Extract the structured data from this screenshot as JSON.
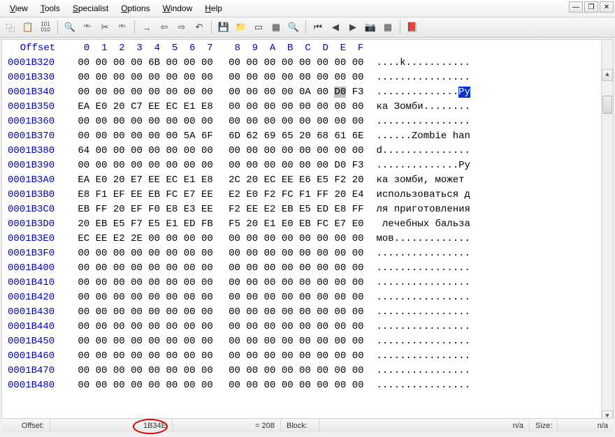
{
  "menu": {
    "view": {
      "u": "V",
      "rest": "iew"
    },
    "tools": {
      "u": "T",
      "rest": "ools"
    },
    "specialist": {
      "u": "S",
      "rest": "pecialist"
    },
    "options": {
      "u": "O",
      "rest": "ptions"
    },
    "window": {
      "u": "W",
      "rest": "indow"
    },
    "help": {
      "u": "H",
      "rest": "elp"
    }
  },
  "toolbar_icons": {
    "copy": "⿻",
    "paste": "📋",
    "binary": "101\n010",
    "find": "🔍",
    "hex1": "ᴴᴱˣ",
    "tool1": "✂",
    "tool2": "ᴴᴱˣ",
    "go": "→",
    "back": "⇦",
    "fwd": "⇨",
    "undo": "↶",
    "disk": "💾",
    "folder": "📁",
    "ram": "▭",
    "calc": "▦",
    "zoom": "🔍",
    "nav1": "⏮",
    "nav2": "◀",
    "nav3": "▶",
    "cam": "📷",
    "grid": "▦",
    "help": "📕"
  },
  "header": {
    "offset_label": "Offset",
    "cols": [
      "0",
      "1",
      "2",
      "3",
      "4",
      "5",
      "6",
      "7",
      "8",
      "9",
      "A",
      "B",
      "C",
      "D",
      "E",
      "F"
    ]
  },
  "rows": [
    {
      "off": "0001B320",
      "h": [
        "00",
        "00",
        "00",
        "00",
        "6B",
        "00",
        "00",
        "00",
        "00",
        "00",
        "00",
        "00",
        "00",
        "00",
        "00",
        "00"
      ],
      "a": "....k..........."
    },
    {
      "off": "0001B330",
      "h": [
        "00",
        "00",
        "00",
        "00",
        "00",
        "00",
        "00",
        "00",
        "00",
        "00",
        "00",
        "00",
        "00",
        "00",
        "00",
        "00"
      ],
      "a": "................"
    },
    {
      "off": "0001B340",
      "h": [
        "00",
        "00",
        "00",
        "00",
        "00",
        "00",
        "00",
        "00",
        "00",
        "00",
        "00",
        "00",
        "0A",
        "00",
        "D0",
        "F3"
      ],
      "a": "..............Ру",
      "sel": 14,
      "hl_start": 14,
      "hl_end": 15
    },
    {
      "off": "0001B350",
      "h": [
        "EA",
        "E0",
        "20",
        "C7",
        "EE",
        "EC",
        "E1",
        "E8",
        "00",
        "00",
        "00",
        "00",
        "00",
        "00",
        "00",
        "00"
      ],
      "a": "ка Зомби........"
    },
    {
      "off": "0001B360",
      "h": [
        "00",
        "00",
        "00",
        "00",
        "00",
        "00",
        "00",
        "00",
        "00",
        "00",
        "00",
        "00",
        "00",
        "00",
        "00",
        "00"
      ],
      "a": "................"
    },
    {
      "off": "0001B370",
      "h": [
        "00",
        "00",
        "00",
        "00",
        "00",
        "00",
        "5A",
        "6F",
        "6D",
        "62",
        "69",
        "65",
        "20",
        "68",
        "61",
        "6E"
      ],
      "a": "......Zombie han"
    },
    {
      "off": "0001B380",
      "h": [
        "64",
        "00",
        "00",
        "00",
        "00",
        "00",
        "00",
        "00",
        "00",
        "00",
        "00",
        "00",
        "00",
        "00",
        "00",
        "00"
      ],
      "a": "d..............."
    },
    {
      "off": "0001B390",
      "h": [
        "00",
        "00",
        "00",
        "00",
        "00",
        "00",
        "00",
        "00",
        "00",
        "00",
        "00",
        "00",
        "00",
        "00",
        "D0",
        "F3"
      ],
      "a": "..............Ру"
    },
    {
      "off": "0001B3A0",
      "h": [
        "EA",
        "E0",
        "20",
        "E7",
        "EE",
        "EC",
        "E1",
        "E8",
        "2C",
        "20",
        "EC",
        "EE",
        "E6",
        "E5",
        "F2",
        "20"
      ],
      "a": "ка зомби, может "
    },
    {
      "off": "0001B3B0",
      "h": [
        "E8",
        "F1",
        "EF",
        "EE",
        "EB",
        "FC",
        "E7",
        "EE",
        "E2",
        "E0",
        "F2",
        "FC",
        "F1",
        "FF",
        "20",
        "E4"
      ],
      "a": "использоваться д"
    },
    {
      "off": "0001B3C0",
      "h": [
        "EB",
        "FF",
        "20",
        "EF",
        "F0",
        "E8",
        "E3",
        "EE",
        "F2",
        "EE",
        "E2",
        "EB",
        "E5",
        "ED",
        "E8",
        "FF"
      ],
      "a": "ля приготовления"
    },
    {
      "off": "0001B3D0",
      "h": [
        "20",
        "EB",
        "E5",
        "F7",
        "E5",
        "E1",
        "ED",
        "FB",
        "F5",
        "20",
        "E1",
        "E0",
        "EB",
        "FC",
        "E7",
        "E0"
      ],
      "a": " лечебных бальза"
    },
    {
      "off": "0001B3E0",
      "h": [
        "EC",
        "EE",
        "E2",
        "2E",
        "00",
        "00",
        "00",
        "00",
        "00",
        "00",
        "00",
        "00",
        "00",
        "00",
        "00",
        "00"
      ],
      "a": "мов............."
    },
    {
      "off": "0001B3F0",
      "h": [
        "00",
        "00",
        "00",
        "00",
        "00",
        "00",
        "00",
        "00",
        "00",
        "00",
        "00",
        "00",
        "00",
        "00",
        "00",
        "00"
      ],
      "a": "................"
    },
    {
      "off": "0001B400",
      "h": [
        "00",
        "00",
        "00",
        "00",
        "00",
        "00",
        "00",
        "00",
        "00",
        "00",
        "00",
        "00",
        "00",
        "00",
        "00",
        "00"
      ],
      "a": "................"
    },
    {
      "off": "0001B410",
      "h": [
        "00",
        "00",
        "00",
        "00",
        "00",
        "00",
        "00",
        "00",
        "00",
        "00",
        "00",
        "00",
        "00",
        "00",
        "00",
        "00"
      ],
      "a": "................"
    },
    {
      "off": "0001B420",
      "h": [
        "00",
        "00",
        "00",
        "00",
        "00",
        "00",
        "00",
        "00",
        "00",
        "00",
        "00",
        "00",
        "00",
        "00",
        "00",
        "00"
      ],
      "a": "................"
    },
    {
      "off": "0001B430",
      "h": [
        "00",
        "00",
        "00",
        "00",
        "00",
        "00",
        "00",
        "00",
        "00",
        "00",
        "00",
        "00",
        "00",
        "00",
        "00",
        "00"
      ],
      "a": "................"
    },
    {
      "off": "0001B440",
      "h": [
        "00",
        "00",
        "00",
        "00",
        "00",
        "00",
        "00",
        "00",
        "00",
        "00",
        "00",
        "00",
        "00",
        "00",
        "00",
        "00"
      ],
      "a": "................"
    },
    {
      "off": "0001B450",
      "h": [
        "00",
        "00",
        "00",
        "00",
        "00",
        "00",
        "00",
        "00",
        "00",
        "00",
        "00",
        "00",
        "00",
        "00",
        "00",
        "00"
      ],
      "a": "................"
    },
    {
      "off": "0001B460",
      "h": [
        "00",
        "00",
        "00",
        "00",
        "00",
        "00",
        "00",
        "00",
        "00",
        "00",
        "00",
        "00",
        "00",
        "00",
        "00",
        "00"
      ],
      "a": "................"
    },
    {
      "off": "0001B470",
      "h": [
        "00",
        "00",
        "00",
        "00",
        "00",
        "00",
        "00",
        "00",
        "00",
        "00",
        "00",
        "00",
        "00",
        "00",
        "00",
        "00"
      ],
      "a": "................"
    },
    {
      "off": "0001B480",
      "h": [
        "00",
        "00",
        "00",
        "00",
        "00",
        "00",
        "00",
        "00",
        "00",
        "00",
        "00",
        "00",
        "00",
        "00",
        "00",
        "00"
      ],
      "a": "................"
    }
  ],
  "status": {
    "offset_label": "Offset:",
    "offset_value": "1B34E",
    "value_label": "= 208",
    "block_label": "Block:",
    "block_value": "n/a",
    "size_label": "Size:",
    "size_value": "n/a"
  }
}
